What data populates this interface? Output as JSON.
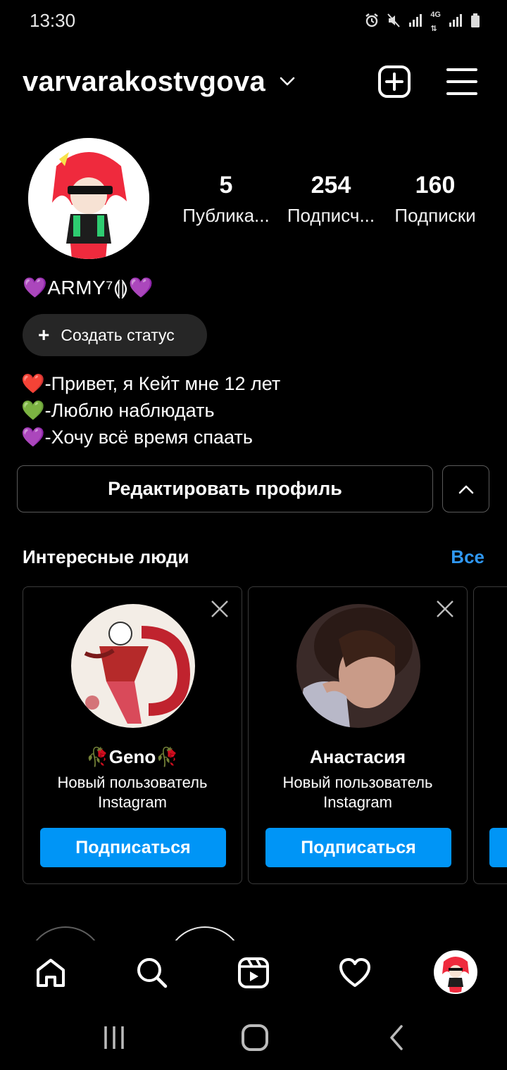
{
  "status_bar": {
    "time": "13:30",
    "network": "4G"
  },
  "header": {
    "username": "varvarakostvgova"
  },
  "profile": {
    "display_name": "💜ARMY⁷⟬⟭💜",
    "stats": [
      {
        "value": "5",
        "label": "Публика..."
      },
      {
        "value": "254",
        "label": "Подписч..."
      },
      {
        "value": "160",
        "label": "Подписки"
      }
    ],
    "create_status_label": "Создать статус",
    "bio": [
      "❤️-Привет, я Кейт мне 12 лет",
      "💚-Люблю наблюдать",
      "💜-Хочу всё время спаать"
    ],
    "edit_button_label": "Редактировать профиль"
  },
  "suggestions": {
    "title": "Интересные люди",
    "see_all": "Все",
    "cards": [
      {
        "name": "🥀Geno🥀",
        "subtitle_line1": "Новый пользователь",
        "subtitle_line2": "Instagram",
        "follow_label": "Подписаться"
      },
      {
        "name": "Анастасия",
        "subtitle_line1": "Новый пользователь",
        "subtitle_line2": "Instagram",
        "follow_label": "Подписаться"
      }
    ]
  },
  "colors": {
    "accent": "#0095f6",
    "link": "#2f97f0",
    "background": "#000000",
    "chip": "#262626"
  },
  "icons": {
    "header": [
      "chevron-down-icon",
      "add-post-icon",
      "menu-icon"
    ],
    "bottom_nav": [
      "home-icon",
      "search-icon",
      "reels-icon",
      "heart-icon",
      "profile-avatar"
    ],
    "system_nav": [
      "recent-apps-icon",
      "home-circle-icon",
      "back-icon"
    ]
  }
}
